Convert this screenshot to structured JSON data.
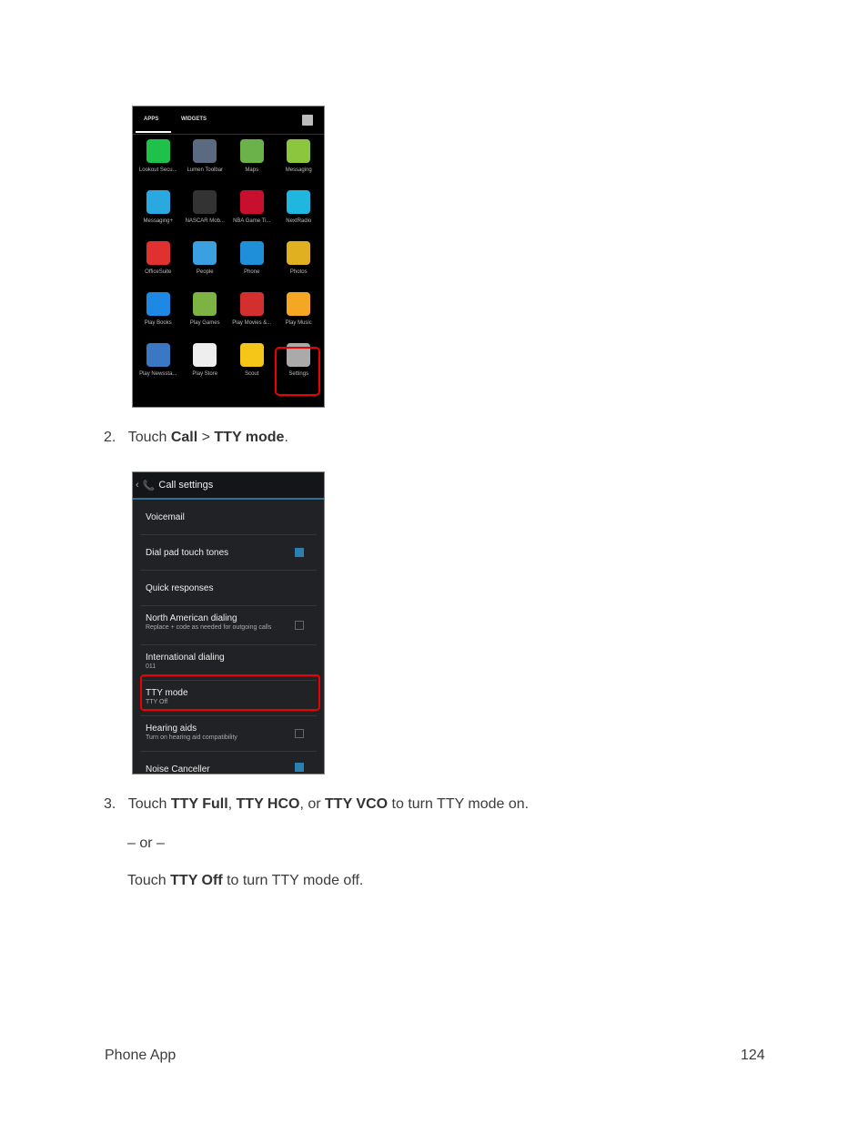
{
  "screenshot1": {
    "tabs": [
      "APPS",
      "WIDGETS"
    ],
    "apps": [
      {
        "label": "Lookout Secu...",
        "icon": "lookout-icon",
        "color": "#1ec24a"
      },
      {
        "label": "Lumen Toolbar",
        "icon": "lumen-icon",
        "color": "#5a6a80"
      },
      {
        "label": "Maps",
        "icon": "maps-icon",
        "color": "#6cb24a"
      },
      {
        "label": "Messaging",
        "icon": "messaging-icon",
        "color": "#8cc63e"
      },
      {
        "label": "Messaging+",
        "icon": "messaging-plus-icon",
        "color": "#2aa8e0"
      },
      {
        "label": "NASCAR Mob...",
        "icon": "nascar-icon",
        "color": "#333333"
      },
      {
        "label": "NBA Game Ti...",
        "icon": "nba-icon",
        "color": "#c8102e"
      },
      {
        "label": "NextRadio",
        "icon": "nextradio-icon",
        "color": "#1fb6e0"
      },
      {
        "label": "OfficeSuite",
        "icon": "officesuite-icon",
        "color": "#e03030"
      },
      {
        "label": "People",
        "icon": "people-icon",
        "color": "#3aa0e0"
      },
      {
        "label": "Phone",
        "icon": "phone-icon",
        "color": "#1e8fd8"
      },
      {
        "label": "Photos",
        "icon": "photos-icon",
        "color": "#e0b020"
      },
      {
        "label": "Play Books",
        "icon": "play-books-icon",
        "color": "#1e88e5"
      },
      {
        "label": "Play Games",
        "icon": "play-games-icon",
        "color": "#7cb342"
      },
      {
        "label": "Play Movies &...",
        "icon": "play-movies-icon",
        "color": "#d32f2f"
      },
      {
        "label": "Play Music",
        "icon": "play-music-icon",
        "color": "#f5a623"
      },
      {
        "label": "Play Newssta...",
        "icon": "play-newsstand-icon",
        "color": "#3b78c4"
      },
      {
        "label": "Play Store",
        "icon": "play-store-icon",
        "color": "#eeeeee"
      },
      {
        "label": "Scout",
        "icon": "scout-icon",
        "color": "#f5c518"
      },
      {
        "label": "Settings",
        "icon": "settings-icon",
        "color": "#aaaaaa"
      }
    ]
  },
  "step2": {
    "num": "2.",
    "pre": "Touch ",
    "b1": "Call",
    "mid": " > ",
    "b2": "TTY mode",
    "post": "."
  },
  "screenshot2": {
    "title": "Call settings",
    "rows": [
      {
        "title": "Voicemail",
        "sub": "",
        "check": null
      },
      {
        "title": "Dial pad touch tones",
        "sub": "",
        "check": true
      },
      {
        "title": "Quick responses",
        "sub": "",
        "check": null
      },
      {
        "title": "North American dialing",
        "sub": "Replace + code as needed for outgoing calls",
        "check": false
      },
      {
        "title": "International dialing",
        "sub": "011",
        "check": null
      },
      {
        "title": "TTY mode",
        "sub": "TTY Off",
        "check": null
      },
      {
        "title": "Hearing aids",
        "sub": "Turn on hearing aid compatibility",
        "check": false
      },
      {
        "title": "Noise Canceller",
        "sub": "",
        "check": true
      }
    ]
  },
  "step3": {
    "num": "3.",
    "pre": "Touch ",
    "b1": "TTY Full",
    "s1": ", ",
    "b2": "TTY HCO",
    "s2": ", or ",
    "b3": "TTY VCO",
    "post": " to turn TTY mode on."
  },
  "or_text": "– or –",
  "step3b": {
    "pre": "Touch ",
    "b1": "TTY Off",
    "post": " to turn TTY mode off."
  },
  "footer": {
    "section": "Phone App",
    "page": "124"
  }
}
